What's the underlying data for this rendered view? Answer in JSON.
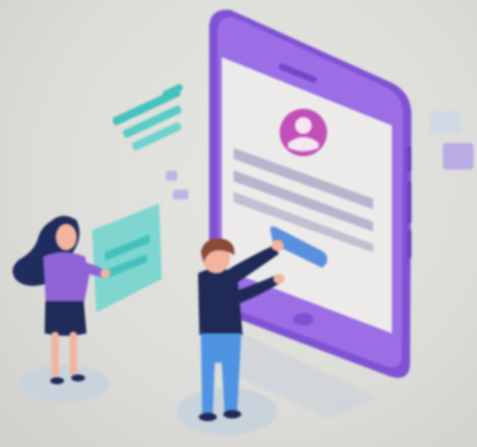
{
  "illustration": {
    "colors": {
      "background": "#dcdcd8",
      "phone_body": "#9b6ee6",
      "phone_body_dark": "#7f52d4",
      "phone_screen": "#ecebea",
      "avatar": "#c24fb8",
      "screen_line": "#b9b4cc",
      "screen_button": "#5a8fe0",
      "teal_card": "#7ed6cf",
      "teal_lines": "#45c2bd",
      "lavender_card": "#b6a6e6",
      "shadow_disc": "#c9d3dc",
      "man_shirt": "#1f2a57",
      "man_pants": "#4f93e3",
      "man_hair": "#8a4a3a",
      "woman_top": "#8f62d6",
      "woman_skirt": "#1f2a57",
      "woman_hair": "#1e2d5e",
      "skin": "#f2b3a0"
    },
    "elements": {
      "phone": "smartphone-illustration",
      "avatar": "user-avatar-icon",
      "man": "man-figure",
      "woman": "woman-figure",
      "card": "floating-message-card"
    }
  }
}
